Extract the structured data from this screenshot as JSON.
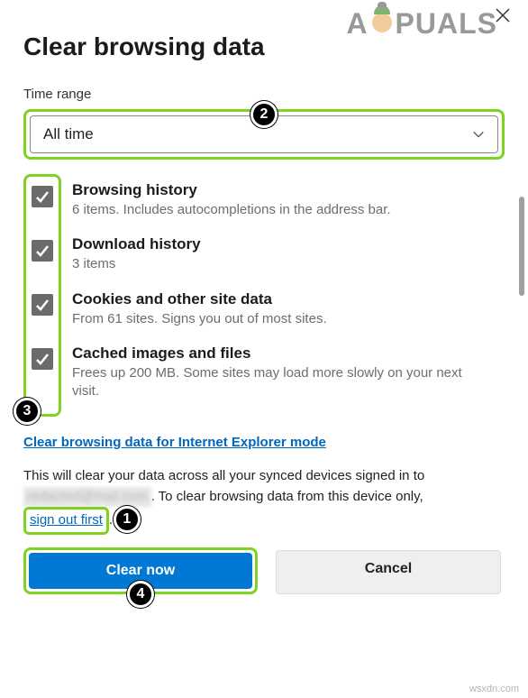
{
  "watermark": {
    "prefix": "A",
    "suffix": "PUALS"
  },
  "dialog": {
    "title": "Clear browsing data",
    "time_label": "Time range",
    "time_value": "All time",
    "items": [
      {
        "title": "Browsing history",
        "desc": "6 items. Includes autocompletions in the address bar."
      },
      {
        "title": "Download history",
        "desc": "3 items"
      },
      {
        "title": "Cookies and other site data",
        "desc": "From 61 sites. Signs you out of most sites."
      },
      {
        "title": "Cached images and files",
        "desc": "Frees up 200 MB. Some sites may load more slowly on your next visit."
      }
    ],
    "ie_link": "Clear browsing data for Internet Explorer mode",
    "sync_text_1": "This will clear your data across all your synced devices signed in to ",
    "sync_blur": "redacted@mail.com",
    "sync_text_2": ". To clear browsing data from this device only, ",
    "signout_link": "sign out first",
    "sync_text_3": ".",
    "primary_btn": "Clear now",
    "secondary_btn": "Cancel"
  },
  "annotations": {
    "b1": "1",
    "b2": "2",
    "b3": "3",
    "b4": "4"
  },
  "footer": "wsxdn.com"
}
